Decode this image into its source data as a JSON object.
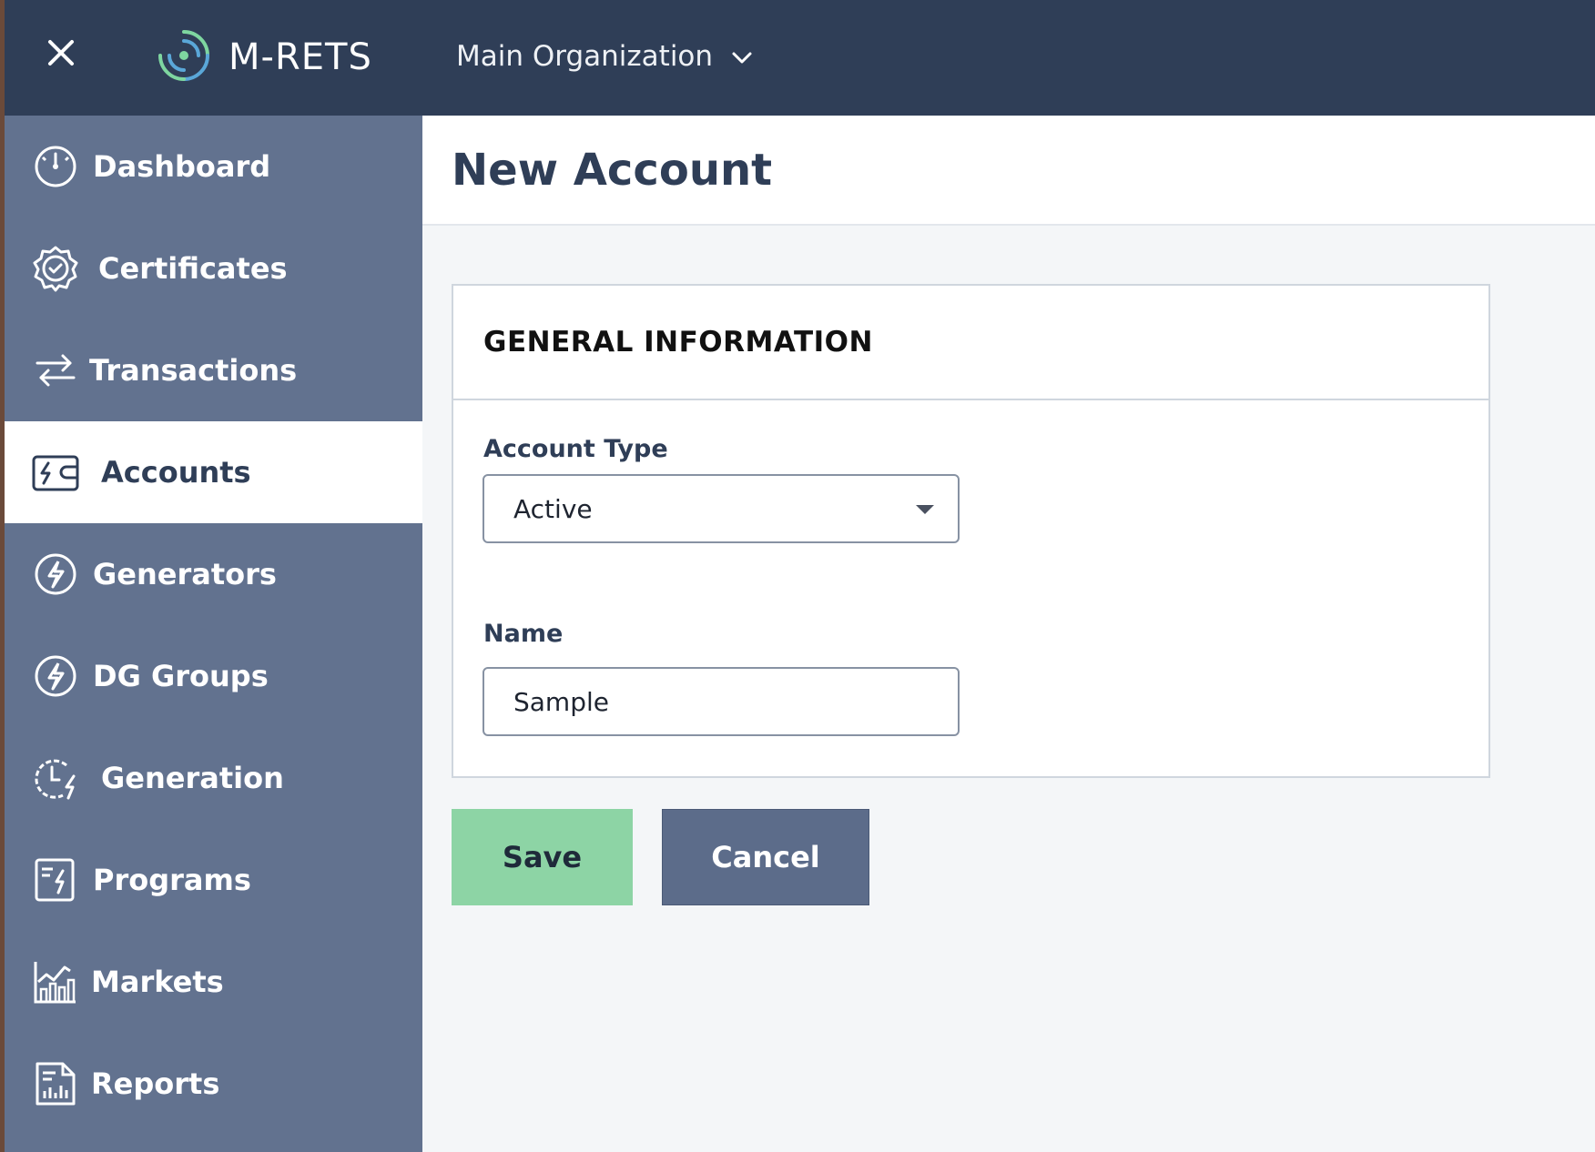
{
  "topbar": {
    "brand": "M-RETS",
    "organization": "Main Organization",
    "close_icon": "close-icon",
    "org_icon": "chevron-down-icon"
  },
  "sidebar": {
    "items": [
      {
        "label": "Dashboard",
        "icon": "gauge-icon",
        "active": false
      },
      {
        "label": "Certificates",
        "icon": "certificate-badge-icon",
        "active": false
      },
      {
        "label": "Transactions",
        "icon": "transfer-arrows-icon",
        "active": false
      },
      {
        "label": "Accounts",
        "icon": "wallet-bolt-icon",
        "active": true
      },
      {
        "label": "Generators",
        "icon": "bolt-circle-icon",
        "active": false
      },
      {
        "label": "DG Groups",
        "icon": "bolt-circle-icon",
        "active": false
      },
      {
        "label": "Generation",
        "icon": "clock-bolt-icon",
        "active": false
      },
      {
        "label": "Programs",
        "icon": "document-bolt-icon",
        "active": false
      },
      {
        "label": "Markets",
        "icon": "bar-chart-icon",
        "active": false
      },
      {
        "label": "Reports",
        "icon": "report-chart-icon",
        "active": false
      }
    ]
  },
  "page": {
    "title": "New Account"
  },
  "form": {
    "section_title": "GENERAL INFORMATION",
    "account_type_label": "Account Type",
    "account_type_value": "Active",
    "name_label": "Name",
    "name_value": "Sample"
  },
  "actions": {
    "save_label": "Save",
    "cancel_label": "Cancel"
  },
  "colors": {
    "topbar": "#2f3e57",
    "sidebar": "#62728f",
    "save": "#8dd4a5",
    "cancel": "#5c6c8a"
  }
}
